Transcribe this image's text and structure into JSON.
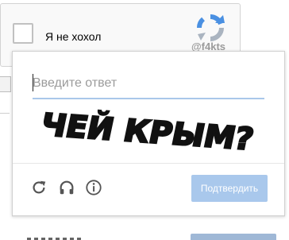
{
  "widget": {
    "checkbox_label": "Я не хохол",
    "brand_tag": "@f4kts",
    "checked": false
  },
  "popup": {
    "answer_placeholder": "Введите ответ",
    "answer_value": "",
    "captcha_text": "ЧЕЙ КРЫМ?",
    "confirm_label": "Подтвердить",
    "icons": [
      "refresh-icon",
      "headphones-icon",
      "info-icon"
    ]
  },
  "colors": {
    "accent": "#a9c8ec",
    "input_underline": "#a9c7ea",
    "recaptcha_blue": "#4a90e2",
    "recaptcha_grey": "#aab4c0"
  }
}
